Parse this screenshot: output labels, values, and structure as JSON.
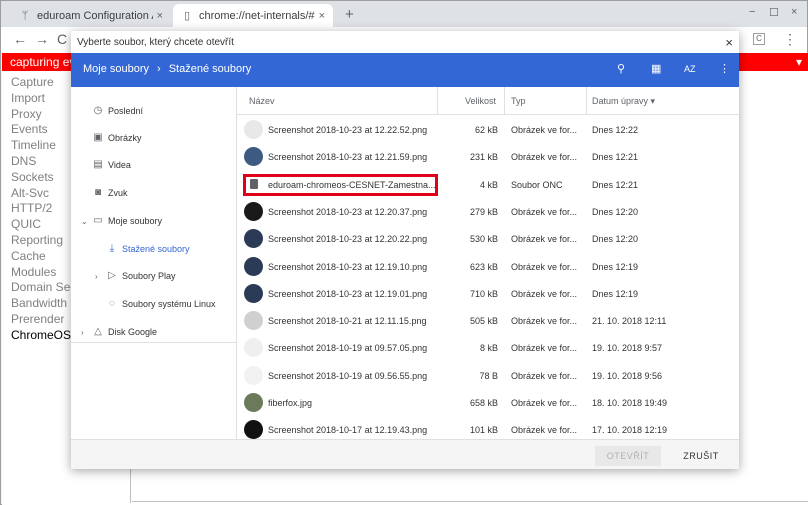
{
  "browser": {
    "tabs": [
      {
        "title": "eduroam Configuration Assistan",
        "icon": "antenna-icon",
        "close": "×"
      },
      {
        "title": "chrome://net-internals/#chrome",
        "icon": "page-icon",
        "close": "×"
      }
    ],
    "new_tab": "+",
    "window_controls": {
      "minimize": "−",
      "maximize": "☐",
      "close": "×"
    },
    "nav": {
      "back": "←",
      "forward": "→",
      "reload": "C"
    },
    "menu": "⋮"
  },
  "netinternals": {
    "capture_bar": "capturing eve",
    "capture_bar_right": "▾",
    "nav_items": [
      "Capture",
      "Import",
      "Proxy",
      "Events",
      "Timeline",
      "DNS",
      "Sockets",
      "Alt-Svc",
      "HTTP/2",
      "QUIC",
      "Reporting",
      "Cache",
      "Modules",
      "Domain Secu",
      "Bandwidth",
      "Prerender",
      "ChromeOS"
    ],
    "selected_item": "ChromeOS"
  },
  "dialog": {
    "title": "Vyberte soubor, který chcete otevřít",
    "close": "×",
    "breadcrumb": {
      "root": "Moje soubory",
      "separator": "›",
      "current": "Stažené soubory"
    },
    "header_icons": [
      "search-icon",
      "grid-view-icon",
      "sort-icon",
      "more-icon"
    ],
    "header_icon_glyphs": {
      "search": "⚲",
      "grid": "▦",
      "sort": "AZ",
      "more": "⋮"
    },
    "sidebar": [
      {
        "label": "Poslední",
        "icon": "clock-icon",
        "glyph": "◷"
      },
      {
        "label": "Obrázky",
        "icon": "image-icon",
        "glyph": "▣"
      },
      {
        "label": "Videa",
        "icon": "video-icon",
        "glyph": "▤"
      },
      {
        "label": "Zvuk",
        "icon": "audio-icon",
        "glyph": "◙"
      },
      {
        "label": "Moje soubory",
        "icon": "computer-icon",
        "glyph": "▭",
        "chevron": "⌄"
      },
      {
        "label": "Stažené soubory",
        "icon": "download-icon",
        "glyph": "⤓"
      },
      {
        "label": "Soubory Play",
        "icon": "play-icon",
        "glyph": "▷",
        "chevron": "›"
      },
      {
        "label": "Soubory systému Linux",
        "icon": "linux-icon",
        "glyph": "◌"
      },
      {
        "label": "Disk Google",
        "icon": "drive-icon",
        "glyph": "△",
        "chevron": "›"
      }
    ],
    "columns": {
      "name": "Název",
      "size": "Velikost",
      "type": "Typ",
      "date": "Datum úpravy",
      "sort_indicator": "▾"
    },
    "files": [
      {
        "name": "Screenshot 2018-10-23 at 12.22.52.png",
        "size": "62 kB",
        "type": "Obrázek ve for...",
        "date": "Dnes 12:22",
        "thumb": "#e8e8e8"
      },
      {
        "name": "Screenshot 2018-10-23 at 12.21.59.png",
        "size": "231 kB",
        "type": "Obrázek ve for...",
        "date": "Dnes 12:21",
        "thumb": "#3d5a80"
      },
      {
        "name": "eduroam-chromeos-CESNET-Zamestna...",
        "size": "4 kB",
        "type": "Soubor ONC",
        "date": "Dnes 12:21",
        "thumb": ""
      },
      {
        "name": "Screenshot 2018-10-23 at 12.20.37.png",
        "size": "279 kB",
        "type": "Obrázek ve for...",
        "date": "Dnes 12:20",
        "thumb": "#1a1a1a"
      },
      {
        "name": "Screenshot 2018-10-23 at 12.20.22.png",
        "size": "530 kB",
        "type": "Obrázek ve for...",
        "date": "Dnes 12:20",
        "thumb": "#2b3a55"
      },
      {
        "name": "Screenshot 2018-10-23 at 12.19.10.png",
        "size": "623 kB",
        "type": "Obrázek ve for...",
        "date": "Dnes 12:19",
        "thumb": "#2b3a55"
      },
      {
        "name": "Screenshot 2018-10-23 at 12.19.01.png",
        "size": "710 kB",
        "type": "Obrázek ve for...",
        "date": "Dnes 12:19",
        "thumb": "#2b3a55"
      },
      {
        "name": "Screenshot 2018-10-21 at 12.11.15.png",
        "size": "505 kB",
        "type": "Obrázek ve for...",
        "date": "21. 10. 2018 12:11",
        "thumb": "#d0d0d0"
      },
      {
        "name": "Screenshot 2018-10-19 at 09.57.05.png",
        "size": "8 kB",
        "type": "Obrázek ve for...",
        "date": "19. 10. 2018 9:57",
        "thumb": "#efefef"
      },
      {
        "name": "Screenshot 2018-10-19 at 09.56.55.png",
        "size": "78 B",
        "type": "Obrázek ve for...",
        "date": "19. 10. 2018 9:56",
        "thumb": "#f2f2f2"
      },
      {
        "name": "fiberfox.jpg",
        "size": "658 kB",
        "type": "Obrázek ve for...",
        "date": "18. 10. 2018 19:49",
        "thumb": "#6b7a5a"
      },
      {
        "name": "Screenshot 2018-10-17 at 12.19.43.png",
        "size": "101 kB",
        "type": "Obrázek ve for...",
        "date": "17. 10. 2018 12:19",
        "thumb": "#111111"
      }
    ],
    "highlighted_file": "eduroam-chromeos-CESNET-Zamestna...",
    "buttons": {
      "open": "OTEVŘÍT",
      "cancel": "ZRUŠIT"
    }
  },
  "colors": {
    "header_blue": "#3367d6",
    "capture_red": "#ff0000",
    "highlight_red": "#e0001a"
  }
}
